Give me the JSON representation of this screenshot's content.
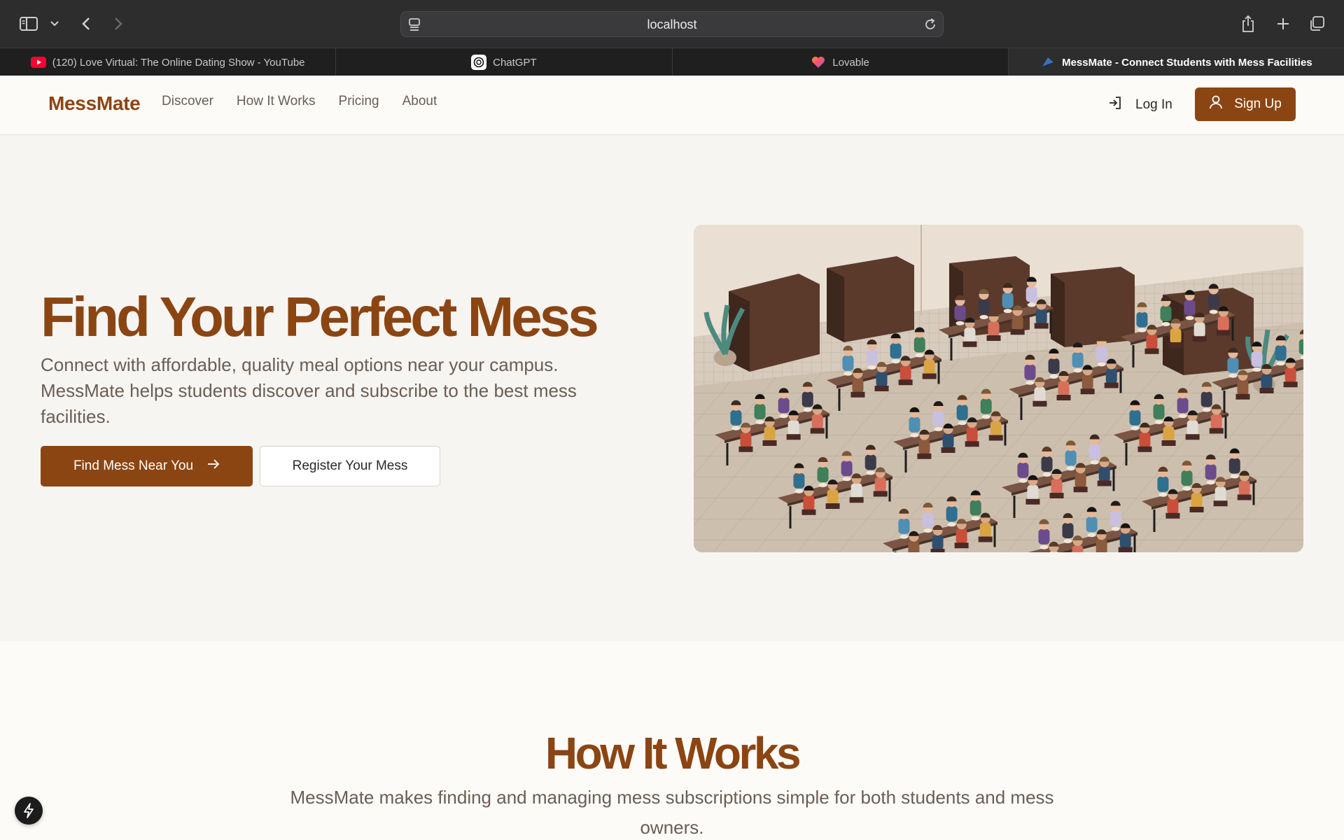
{
  "browser": {
    "url": "localhost",
    "tabs": [
      {
        "title": "(120) Love Virtual: The Online Dating Show - YouTube",
        "icon": "youtube-icon",
        "active": false
      },
      {
        "title": "ChatGPT",
        "icon": "chatgpt-icon",
        "active": false
      },
      {
        "title": "Lovable",
        "icon": "lovable-heart-icon",
        "active": false
      },
      {
        "title": "MessMate - Connect Students with Mess Facilities",
        "icon": "messmate-favicon",
        "active": true
      }
    ]
  },
  "header": {
    "logo": "MessMate",
    "nav": [
      "Discover",
      "How It Works",
      "Pricing",
      "About"
    ],
    "login_label": "Log In",
    "signup_label": "Sign Up"
  },
  "hero": {
    "title": "Find Your Perfect Mess",
    "subtitle": "Connect with affordable, quality meal options near your campus. MessMate helps students discover and subscribe to the best mess facilities.",
    "primary_cta": "Find Mess Near You",
    "secondary_cta": "Register Your Mess",
    "image": "illustration-students-dining-hall"
  },
  "how_it_works": {
    "title": "How It Works",
    "subtitle": "MessMate makes finding and managing mess subscriptions simple for both students and mess owners."
  },
  "colors": {
    "brand": "#8b4513",
    "chrome_bg": "#2d2d2e",
    "page_bg": "#f7f5f2"
  }
}
